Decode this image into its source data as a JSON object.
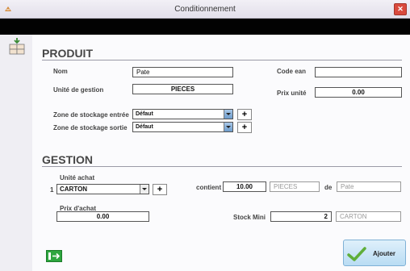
{
  "window": {
    "title": "Conditionnement",
    "close_label": "✕"
  },
  "produit": {
    "heading": "PRODUIT",
    "nom_label": "Nom",
    "nom_value": "Pate",
    "code_ean_label": "Code ean",
    "code_ean_value": "",
    "unite_gestion_label": "Unité de gestion",
    "unite_gestion_value": "PIECES",
    "prix_unite_label": "Prix unité",
    "prix_unite_value": "0.00",
    "zone_entree_label": "Zone de stockage entrée",
    "zone_entree_value": "Défaut",
    "zone_sortie_label": "Zone de stockage sortie",
    "zone_sortie_value": "Défaut",
    "plus_label": "+"
  },
  "gestion": {
    "heading": "GESTION",
    "unite_achat_label": "Unité achat",
    "row_number": "1",
    "unite_achat_value": "CARTON",
    "contient_label": "contient",
    "contient_value": "10.00",
    "contient_unit": "PIECES",
    "de_label": "de",
    "de_value": "Pate",
    "prix_achat_label": "Prix d'achat",
    "prix_achat_value": "0.00",
    "stock_mini_label": "Stock Mini",
    "stock_mini_value": "2",
    "stock_mini_unit": "CARTON"
  },
  "footer": {
    "ajouter_label": "Ajouter"
  },
  "icons": [
    "app-icon",
    "close-icon",
    "conditionnement-icon",
    "dropdown-arrow-icon",
    "plus-icon",
    "exit-icon",
    "check-icon"
  ]
}
